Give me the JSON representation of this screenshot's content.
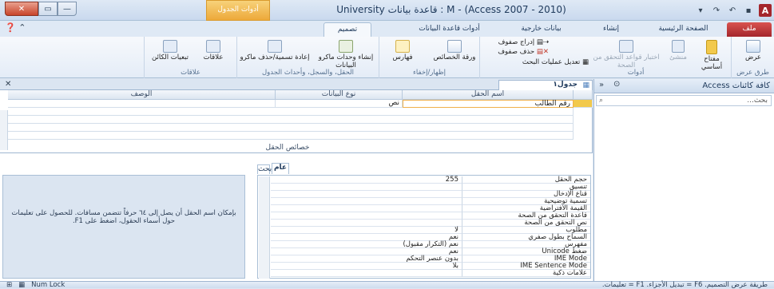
{
  "window": {
    "title": "M - (Access 2007 - 2010) : قاعدة بيانات University",
    "context_tab": "أدوات الجدول",
    "app_icon": "A"
  },
  "tabs": {
    "file": "ملف",
    "home": "الصفحة الرئيسية",
    "create": "إنشاء",
    "external": "بيانات خارجية",
    "dbtools": "أدوات قاعدة البيانات",
    "design": "تصميم"
  },
  "ribbon": {
    "views": {
      "view": "عرض",
      "label": "طرق عرض"
    },
    "tools": {
      "primary_key": "مفتاح أساسي",
      "builder": "منشئ",
      "test_rules": "اختبار قواعد التحقق من الصحة",
      "insert_rows": "إدراج صفوف",
      "delete_rows": "حذف صفوف",
      "modify_lookups": "تعديل عمليات البحث",
      "label": "أدوات"
    },
    "show_hide": {
      "property_sheet": "ورقة الخصائص",
      "indexes": "فهارس",
      "label": "إظهار/إخفاء"
    },
    "field_events": {
      "create_macros": "إنشاء وحدات ماكرو البيانات",
      "rename_macro": "إعادة تسمية/حذف ماكرو",
      "label": "الحقل، والسجل، وأحداث الجدول"
    },
    "relationships": {
      "relationships": "علاقات",
      "dependencies": "تبعيات الكائن",
      "label": "علاقات"
    }
  },
  "nav": {
    "title": "كافة كائنات Access",
    "search_placeholder": "بحث..."
  },
  "doc": {
    "tab_label": "جدول١"
  },
  "grid": {
    "headers": [
      "اسم الحقل",
      "نوع البيانات",
      "الوصف"
    ],
    "rows": [
      {
        "name": "رقم الطالب",
        "type": "نص",
        "desc": ""
      }
    ]
  },
  "field_properties": {
    "label": "خصائص الحقل",
    "tab_general": "عام",
    "tab_lookup": "بحث",
    "props": [
      [
        "حجم الحقل",
        "255"
      ],
      [
        "تنسيق",
        ""
      ],
      [
        "قناع الإدخال",
        ""
      ],
      [
        "تسمية توضيحية",
        ""
      ],
      [
        "القيمة الافتراضية",
        ""
      ],
      [
        "قاعدة التحقق من الصحة",
        ""
      ],
      [
        "نص التحقق من الصحة",
        ""
      ],
      [
        "مطلوب",
        "لا"
      ],
      [
        "السماح بطول صفري",
        "نعم"
      ],
      [
        "مفهرس",
        "نعم (التكرار مقبول)"
      ],
      [
        "ضغط Unicode",
        "نعم"
      ],
      [
        "IME Mode",
        "بدون عنصر التحكم"
      ],
      [
        "IME Sentence Mode",
        "بلا"
      ],
      [
        "علامات ذكية",
        ""
      ]
    ],
    "hint": "بإمكان اسم الحقل أن يصل إلى ٦٤ حرفاً تتضمن مسافات. للحصول على تعليمات حول أسماء الحقول، اضغط على F1."
  },
  "status": {
    "text": "طريقة عرض التصميم. F6 = تبديل الأجزاء. F1 = تعليمات.",
    "numlock": "Num Lock"
  }
}
